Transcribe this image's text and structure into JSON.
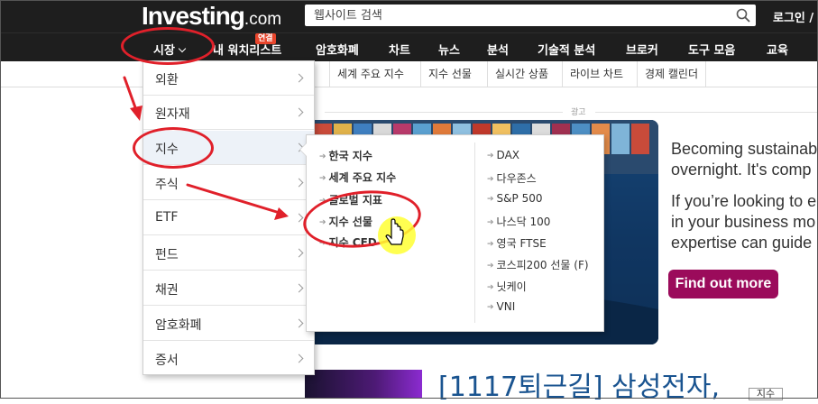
{
  "header": {
    "logo_main": "Investing",
    "logo_suffix": ".com",
    "search_placeholder": "웹사이트 검색",
    "login_label": "로그인 /"
  },
  "nav": {
    "market_label": "시장",
    "watchlist_label": "내 워치리스트",
    "badge_label": "연결",
    "items": [
      "암호화폐",
      "차트",
      "뉴스",
      "분석",
      "기술적 분석",
      "브로커",
      "도구 모음",
      "교육"
    ]
  },
  "subnav": {
    "items": [
      "세계 주요 지수",
      "지수 선물",
      "실시간 상품",
      "라이브 차트",
      "경제 캘린더"
    ]
  },
  "dropdown": {
    "items": [
      {
        "label": "외환"
      },
      {
        "label": "원자재"
      },
      {
        "label": "지수"
      },
      {
        "label": "주식"
      },
      {
        "label": "ETF"
      },
      {
        "label": "펀드"
      },
      {
        "label": "채권"
      },
      {
        "label": "암호화폐"
      },
      {
        "label": "증서"
      }
    ]
  },
  "submenu": {
    "left": [
      "한국 지수",
      "세계 주요 지수",
      "글로벌 지표",
      "지수 선물",
      "지수 CFD"
    ],
    "right": [
      "DAX",
      "다우존스",
      "S&P 500",
      "나스닥 100",
      "영국 FTSE",
      "코스피200 선물 (F)",
      "닛케이",
      "VNI"
    ]
  },
  "ad": {
    "label": "광고",
    "line1": "Becoming sustainab",
    "line2": "overnight. It's comp",
    "line3": "If you’re looking to e",
    "line4": "in your business mo",
    "line5": "expertise can guide",
    "button_label": "Find out more"
  },
  "headline": "[1117퇴근길] 삼성전자,",
  "corner_button": "지수",
  "colors": {
    "header_bg": "#1e1e1e",
    "annotation_red": "#e0202a",
    "ad_button": "#9b0b5b",
    "badge": "#e8452c",
    "headline_blue": "#1a5490"
  }
}
